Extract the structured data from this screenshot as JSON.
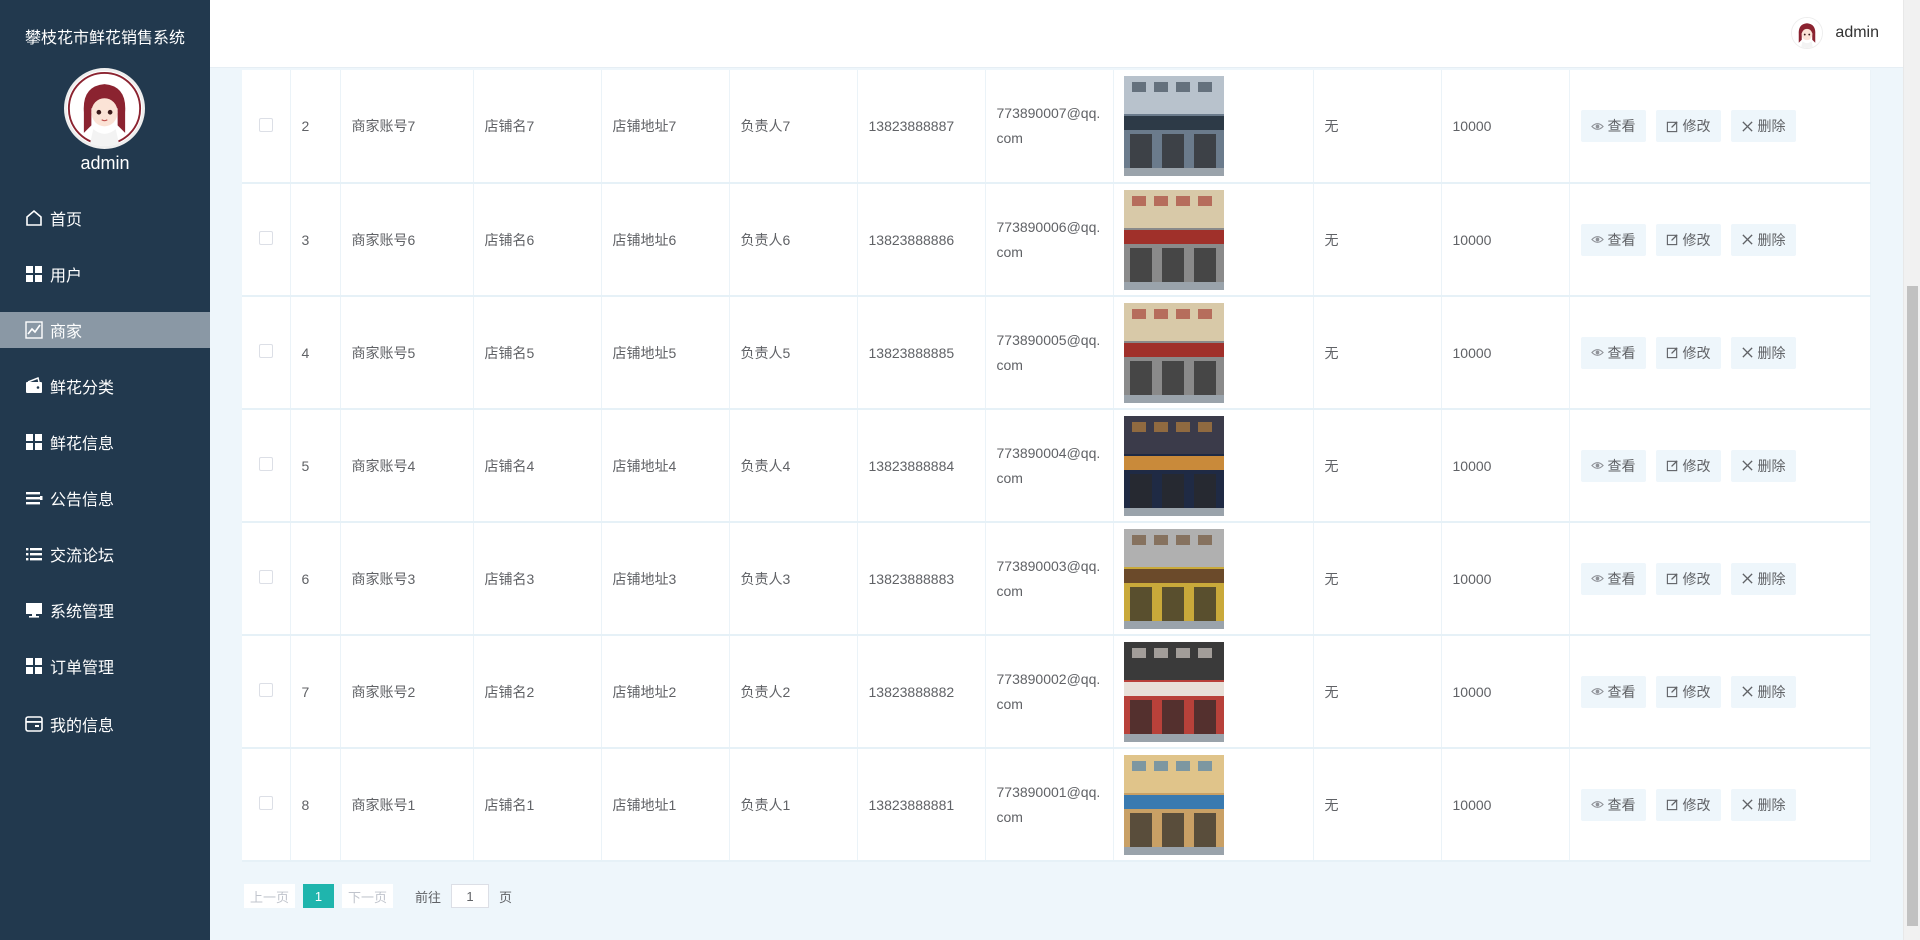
{
  "app": {
    "title": "攀枝花市鲜花销售系统",
    "sidebar_username": "admin",
    "top_username": "admin",
    "accent_color": "#1fb5ad",
    "sidebar_color": "#22394e"
  },
  "menu": [
    {
      "label": "首页",
      "icon": "home-icon",
      "active": false
    },
    {
      "label": "用户",
      "icon": "grid-icon",
      "active": false
    },
    {
      "label": "商家",
      "icon": "chart-icon",
      "active": true
    },
    {
      "label": "鲜花分类",
      "icon": "wallet-icon",
      "active": false
    },
    {
      "label": "鲜花信息",
      "icon": "grid-icon",
      "active": false
    },
    {
      "label": "公告信息",
      "icon": "list-icon",
      "active": false
    },
    {
      "label": "交流论坛",
      "icon": "list-icon",
      "active": false
    },
    {
      "label": "系统管理",
      "icon": "monitor-icon",
      "active": false
    },
    {
      "label": "订单管理",
      "icon": "grid-icon",
      "active": false
    },
    {
      "label": "我的信息",
      "icon": "card-icon",
      "active": false
    }
  ],
  "actions": {
    "view": "查看",
    "edit": "修改",
    "delete": "删除"
  },
  "rows": [
    {
      "index": "2",
      "account": "商家账号7",
      "shop": "店铺名7",
      "address": "店铺地址7",
      "owner": "负责人7",
      "phone": "13823888887",
      "email": "773890007@qq.com",
      "note": "无",
      "amount": "10000",
      "photo": "storefront-photo"
    },
    {
      "index": "3",
      "account": "商家账号6",
      "shop": "店铺名6",
      "address": "店铺地址6",
      "owner": "负责人6",
      "phone": "13823888886",
      "email": "773890006@qq.com",
      "note": "无",
      "amount": "10000",
      "photo": "storefront-photo"
    },
    {
      "index": "4",
      "account": "商家账号5",
      "shop": "店铺名5",
      "address": "店铺地址5",
      "owner": "负责人5",
      "phone": "13823888885",
      "email": "773890005@qq.com",
      "note": "无",
      "amount": "10000",
      "photo": "storefront-photo"
    },
    {
      "index": "5",
      "account": "商家账号4",
      "shop": "店铺名4",
      "address": "店铺地址4",
      "owner": "负责人4",
      "phone": "13823888884",
      "email": "773890004@qq.com",
      "note": "无",
      "amount": "10000",
      "photo": "night-street-photo"
    },
    {
      "index": "6",
      "account": "商家账号3",
      "shop": "店铺名3",
      "address": "店铺地址3",
      "owner": "负责人3",
      "phone": "13823888883",
      "email": "773890003@qq.com",
      "note": "无",
      "amount": "10000",
      "photo": "storefront-photo"
    },
    {
      "index": "7",
      "account": "商家账号2",
      "shop": "店铺名2",
      "address": "店铺地址2",
      "owner": "负责人2",
      "phone": "13823888882",
      "email": "773890002@qq.com",
      "note": "无",
      "amount": "10000",
      "photo": "storefront-photo"
    },
    {
      "index": "8",
      "account": "商家账号1",
      "shop": "店铺名1",
      "address": "店铺地址1",
      "owner": "负责人1",
      "phone": "13823888881",
      "email": "773890001@qq.com",
      "note": "无",
      "amount": "10000",
      "photo": "storefront-photo"
    }
  ],
  "pagination": {
    "prev": "上一页",
    "current": "1",
    "next": "下一页",
    "goto_label": "前往",
    "goto_value": "1",
    "page_suffix": "页"
  }
}
